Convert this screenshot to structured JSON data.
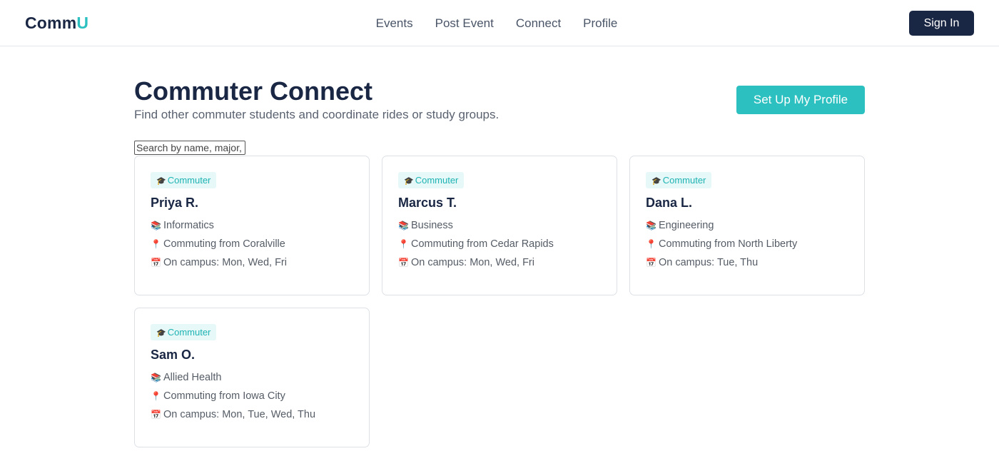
{
  "nav": {
    "logo_main": "Comm",
    "logo_accent": "U",
    "links": [
      "Events",
      "Post Event",
      "Connect",
      "Profile"
    ],
    "signin_label": "Sign In"
  },
  "header": {
    "title": "Commuter Connect",
    "subtitle": "Find other commuter students and coordinate rides or study groups.",
    "setup_label": "Set Up My Profile"
  },
  "search": {
    "placeholder": "Search by name, major, or town",
    "value": ""
  },
  "icons": {
    "badge": "graduation-cap-icon",
    "major": "books-icon",
    "from": "pin-icon",
    "days": "calendar-icon"
  },
  "colors": {
    "brand_dark": "#1a2744",
    "accent": "#2cc0c0"
  },
  "cards": [
    {
      "badge": "Commuter",
      "name": "Priya R.",
      "major": "Informatics",
      "from": "Commuting from Coralville",
      "days": "On campus: Mon, Wed, Fri"
    },
    {
      "badge": "Commuter",
      "name": "Marcus T.",
      "major": "Business",
      "from": "Commuting from Cedar Rapids",
      "days": "On campus: Mon, Wed, Fri"
    },
    {
      "badge": "Commuter",
      "name": "Dana L.",
      "major": "Engineering",
      "from": "Commuting from North Liberty",
      "days": "On campus: Tue, Thu"
    },
    {
      "badge": "Commuter",
      "name": "Sam O.",
      "major": "Allied Health",
      "from": "Commuting from Iowa City",
      "days": "On campus: Mon, Tue, Wed, Thu"
    }
  ]
}
